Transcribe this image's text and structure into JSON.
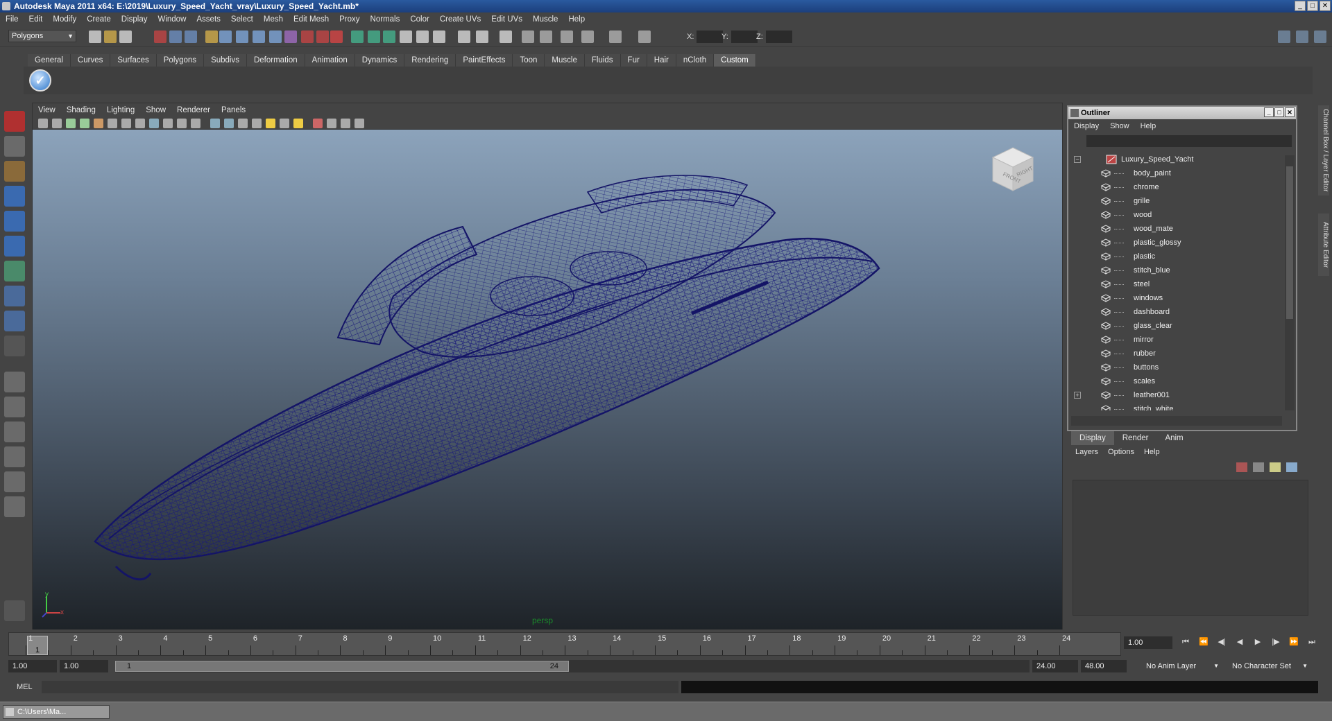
{
  "window": {
    "title": "Autodesk Maya 2011 x64: E:\\2019\\Luxury_Speed_Yacht_vray\\Luxury_Speed_Yacht.mb*"
  },
  "menubar": [
    "File",
    "Edit",
    "Modify",
    "Create",
    "Display",
    "Window",
    "Assets",
    "Select",
    "Mesh",
    "Edit Mesh",
    "Proxy",
    "Normals",
    "Color",
    "Create UVs",
    "Edit UVs",
    "Muscle",
    "Help"
  ],
  "toolbar": {
    "mode": "Polygons",
    "x_label": "X:",
    "y_label": "Y:",
    "z_label": "Z:"
  },
  "shelf_tabs": [
    "General",
    "Curves",
    "Surfaces",
    "Polygons",
    "Subdivs",
    "Deformation",
    "Animation",
    "Dynamics",
    "Rendering",
    "PaintEffects",
    "Toon",
    "Muscle",
    "Fluids",
    "Fur",
    "Hair",
    "nCloth",
    "Custom"
  ],
  "active_shelf_tab": "Custom",
  "viewport": {
    "menu": [
      "View",
      "Shading",
      "Lighting",
      "Show",
      "Renderer",
      "Panels"
    ],
    "camera_label": "persp",
    "viewcube_front": "FRONT",
    "viewcube_right": "RIGHT",
    "axis_x": "x",
    "axis_y": "y",
    "wire_color": "#1a1a7a"
  },
  "outliner": {
    "title": "Outliner",
    "menu": [
      "Display",
      "Show",
      "Help"
    ],
    "root": "Luxury_Speed_Yacht",
    "root_expander": "−",
    "items": [
      "body_paint",
      "chrome",
      "grille",
      "wood",
      "wood_mate",
      "plastic_glossy",
      "plastic",
      "stitch_blue",
      "steel",
      "windows",
      "dashboard",
      "glass_clear",
      "mirror",
      "rubber",
      "buttons",
      "scales",
      "leather001",
      "stitch_white"
    ],
    "expandable": "leather001",
    "item_expander": "+"
  },
  "side_tabs": [
    "Channel Box / Layer Editor",
    "Attribute Editor"
  ],
  "layers": {
    "tabs": [
      "Display",
      "Render",
      "Anim"
    ],
    "active_tab": "Display",
    "menu": [
      "Layers",
      "Options",
      "Help"
    ]
  },
  "timeline": {
    "ticks": [
      "1",
      "2",
      "3",
      "4",
      "5",
      "6",
      "7",
      "8",
      "9",
      "10",
      "11",
      "12",
      "13",
      "14",
      "15",
      "16",
      "17",
      "18",
      "19",
      "20",
      "21",
      "22",
      "23",
      "24"
    ],
    "current_frame": "1",
    "current_time": "1.00"
  },
  "range": {
    "start_time": "1.00",
    "playback_start": "1.00",
    "range_start": "1",
    "range_end": "24",
    "playback_end": "24.00",
    "end_time": "48.00",
    "anim_layer": "No Anim Layer",
    "character_set": "No Character Set"
  },
  "command_line": {
    "label": "MEL"
  },
  "taskbar": {
    "item": "C:\\Users\\Ma..."
  }
}
